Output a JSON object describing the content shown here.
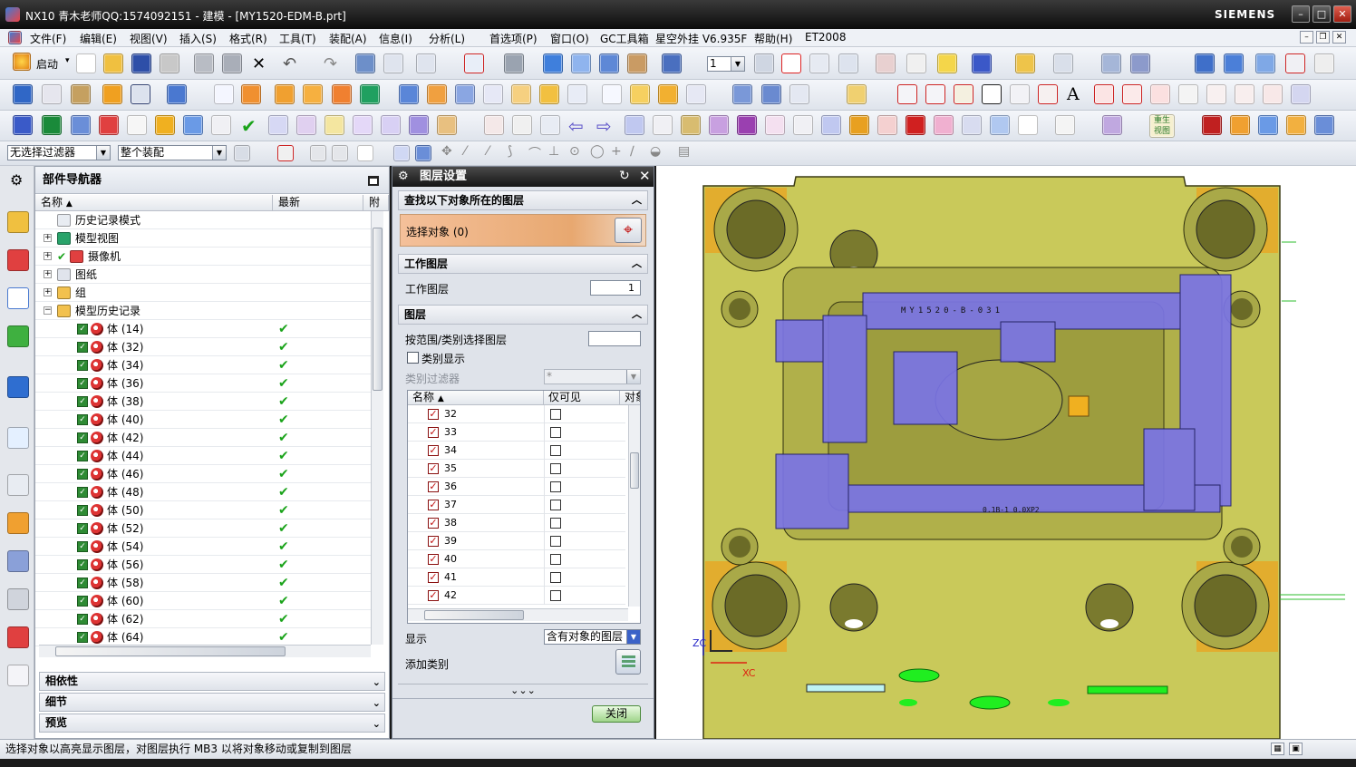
{
  "window": {
    "title": "NX10 青木老师QQ:1574092151 - 建模 - [MY1520-EDM-B.prt]",
    "brand": "SIEMENS",
    "minimize": "–",
    "maximize": "□",
    "close": "✕"
  },
  "menu": {
    "items": [
      "文件(F)",
      "编辑(E)",
      "视图(V)",
      "插入(S)",
      "格式(R)",
      "工具(T)",
      "装配(A)",
      "信息(I)",
      "分析(L)",
      "首选项(P)",
      "窗口(O)",
      "GC工具箱",
      "星空外挂 V6.935F",
      "帮助(H)",
      "ET2008"
    ]
  },
  "toolbar": {
    "start_label": "启动",
    "layer_value": "1",
    "filter_value": "无选择过滤器",
    "assembly_value": "整个装配",
    "reset_view_label": "重生视图"
  },
  "navigator": {
    "title": "部件导航器",
    "col_name": "名称",
    "col_latest": "最新",
    "col_attach": "附",
    "tree": [
      {
        "label": "历史记录模式",
        "icon": "clock-icon"
      },
      {
        "label": "模型视图",
        "icon": "model-views-icon"
      },
      {
        "label": "摄像机",
        "icon": "camera-icon"
      },
      {
        "label": "图纸",
        "icon": "drawing-icon"
      },
      {
        "label": "组",
        "icon": "folder-icon"
      },
      {
        "label": "模型历史记录",
        "icon": "folder-icon"
      }
    ],
    "bodies": [
      "体 (14)",
      "体 (32)",
      "体 (34)",
      "体 (36)",
      "体 (38)",
      "体 (40)",
      "体 (42)",
      "体 (44)",
      "体 (46)",
      "体 (48)",
      "体 (50)",
      "体 (52)",
      "体 (54)",
      "体 (56)",
      "体 (58)",
      "体 (60)",
      "体 (62)",
      "体 (64)"
    ],
    "latest_mark": "✔",
    "sections": [
      "相依性",
      "细节",
      "预览"
    ]
  },
  "dialog": {
    "title": "图层设置",
    "find_group": "查找以下对象所在的图层",
    "select_object": "选择对象 (0)",
    "work_layer_group": "工作图层",
    "work_layer_label": "工作图层",
    "work_layer_value": "1",
    "layers_group": "图层",
    "range_label": "按范围/类别选择图层",
    "range_value": "",
    "category_display": "类别显示",
    "category_filter_label": "类别过滤器",
    "category_filter_value": "*",
    "list_col_name": "名称",
    "list_col_visible": "仅可见",
    "list_col_objects": "对象",
    "layers": [
      "32",
      "33",
      "34",
      "35",
      "36",
      "37",
      "38",
      "39",
      "40",
      "41",
      "42"
    ],
    "display_label": "显示",
    "display_value": "含有对象的图层",
    "add_category_label": "添加类别",
    "more_label": "⌄⌄⌄",
    "close_button": "关闭"
  },
  "viewport": {
    "axis_zc": "ZC",
    "axis_xc": "XC",
    "plate_engraving": "MY1520-B-031",
    "plate_note": "0.1B-1 0.0XP2"
  },
  "status": {
    "text": "选择对象以高亮显示图层，对图层执行 MB3 以将对象移动或复制到图层"
  },
  "colors": {
    "mold_yellow": "#c9c95a",
    "mold_dark": "#6d6d28",
    "electrode_blue": "#7a74e6",
    "accent_orange": "#e8a870"
  }
}
